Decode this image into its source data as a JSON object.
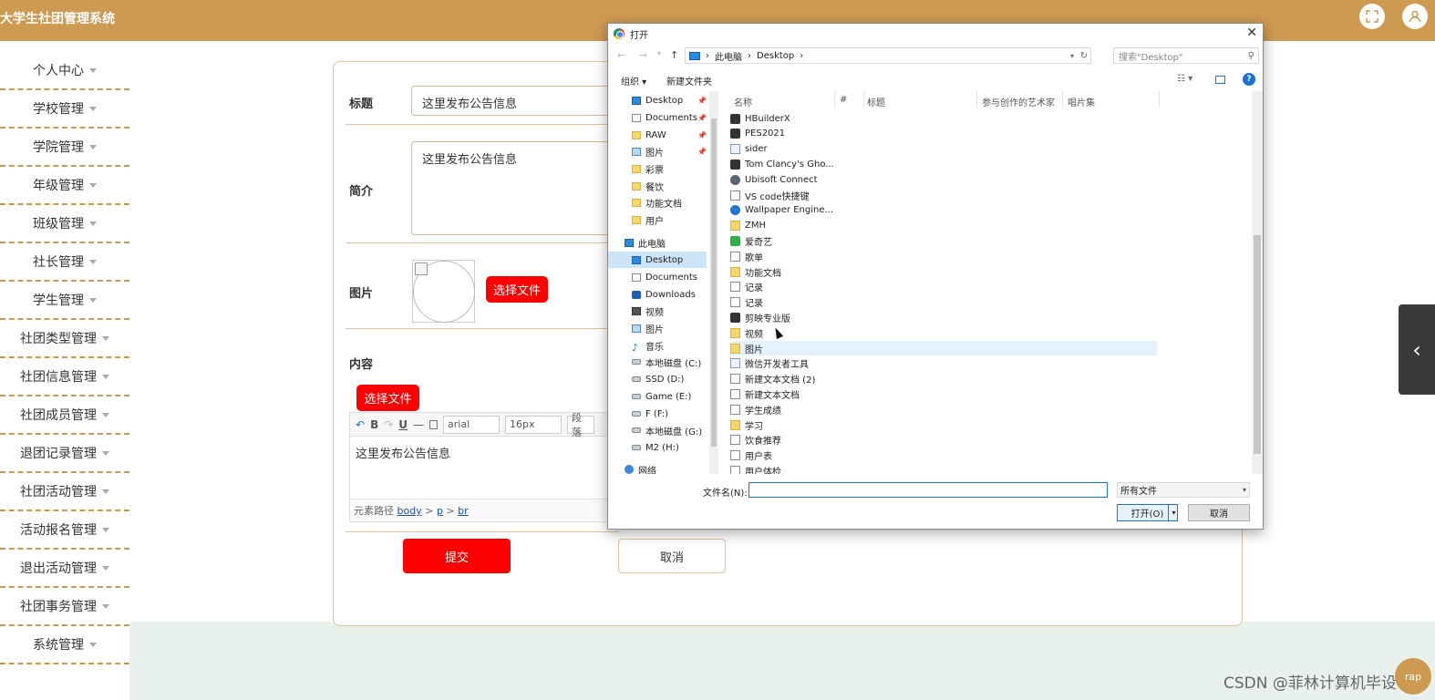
{
  "app": {
    "title": "大学生社团管理系统"
  },
  "sidebar": {
    "items": [
      {
        "label": "个人中心"
      },
      {
        "label": "学校管理"
      },
      {
        "label": "学院管理"
      },
      {
        "label": "年级管理"
      },
      {
        "label": "班级管理"
      },
      {
        "label": "社长管理"
      },
      {
        "label": "学生管理"
      },
      {
        "label": "社团类型管理"
      },
      {
        "label": "社团信息管理"
      },
      {
        "label": "社团成员管理"
      },
      {
        "label": "退团记录管理"
      },
      {
        "label": "社团活动管理"
      },
      {
        "label": "活动报名管理"
      },
      {
        "label": "退出活动管理"
      },
      {
        "label": "社团事务管理"
      },
      {
        "label": "系统管理"
      }
    ]
  },
  "form": {
    "title_label": "标题",
    "title_value": "这里发布公告信息",
    "intro_label": "简介",
    "intro_value": "这里发布公告信息",
    "image_label": "图片",
    "choose_file": "选择文件",
    "content_label": "内容",
    "content_choose_file": "选择文件",
    "editor": {
      "font": "arial",
      "size": "16px",
      "para": "段落",
      "content": "这里发布公告信息",
      "path_label": "元素路径",
      "path": [
        "body",
        "p",
        "br"
      ],
      "bold": "B",
      "underline": "U",
      "hr": "—"
    },
    "submit": "提交",
    "cancel": "取消"
  },
  "watermark": "CSDN @菲林计算机毕设",
  "corner_badge": "rap",
  "dialog": {
    "title": "打开",
    "breadcrumb": [
      "此电脑",
      "Desktop"
    ],
    "search_placeholder": "搜索\"Desktop\"",
    "organize": "组织 ▾",
    "new_folder": "新建文件夹",
    "help": "?",
    "nav": [
      {
        "label": "Desktop",
        "icon": "blue",
        "pin": true
      },
      {
        "label": "Documents",
        "icon": "doc",
        "pin": true
      },
      {
        "label": "RAW",
        "icon": "folder",
        "pin": true
      },
      {
        "label": "图片",
        "icon": "pic",
        "pin": true
      },
      {
        "label": "彩票",
        "icon": "folder"
      },
      {
        "label": "餐饮",
        "icon": "folder"
      },
      {
        "label": "功能文档",
        "icon": "folder"
      },
      {
        "label": "用户",
        "icon": "folder"
      },
      {
        "label": "此电脑",
        "icon": "blue"
      },
      {
        "label": "Desktop",
        "icon": "blue",
        "selected": true
      },
      {
        "label": "Documents",
        "icon": "doc"
      },
      {
        "label": "Downloads",
        "icon": "down"
      },
      {
        "label": "视频",
        "icon": "video"
      },
      {
        "label": "图片",
        "icon": "pic"
      },
      {
        "label": "音乐",
        "icon": "music"
      },
      {
        "label": "本地磁盘 (C:)",
        "icon": "drive"
      },
      {
        "label": "SSD (D:)",
        "icon": "drive"
      },
      {
        "label": "Game (E:)",
        "icon": "drive"
      },
      {
        "label": "F (F:)",
        "icon": "drive"
      },
      {
        "label": "本地磁盘 (G:)",
        "icon": "drive"
      },
      {
        "label": "M2 (H:)",
        "icon": "drive"
      },
      {
        "label": "网络",
        "icon": "net"
      }
    ],
    "columns": [
      "名称",
      "#",
      "标题",
      "参与创作的艺术家",
      "唱片集"
    ],
    "files": [
      {
        "name": "HBuilderX",
        "icon": "app"
      },
      {
        "name": "PES2021",
        "icon": "app"
      },
      {
        "name": "sider",
        "icon": "shortcut"
      },
      {
        "name": "Tom Clancy's Gho...",
        "icon": "app"
      },
      {
        "name": "Ubisoft Connect",
        "icon": "gray"
      },
      {
        "name": "VS code快捷键",
        "icon": "txt"
      },
      {
        "name": "Wallpaper Engine...",
        "icon": "blue"
      },
      {
        "name": "ZMH",
        "icon": "folder"
      },
      {
        "name": "爱奇艺",
        "icon": "green"
      },
      {
        "name": "歌单",
        "icon": "txt"
      },
      {
        "name": "功能文档",
        "icon": "folder"
      },
      {
        "name": "记录",
        "icon": "txt"
      },
      {
        "name": "记录",
        "icon": "txt"
      },
      {
        "name": "剪映专业版",
        "icon": "app"
      },
      {
        "name": "视频",
        "icon": "folder"
      },
      {
        "name": "图片",
        "icon": "folder",
        "hover": true
      },
      {
        "name": "微信开发者工具",
        "icon": "shortcut"
      },
      {
        "name": "新建文本文档 (2)",
        "icon": "txt"
      },
      {
        "name": "新建文本文档",
        "icon": "txt"
      },
      {
        "name": "学生成绩",
        "icon": "txt"
      },
      {
        "name": "学习",
        "icon": "folder"
      },
      {
        "name": "饮食推荐",
        "icon": "txt"
      },
      {
        "name": "用户表",
        "icon": "txt"
      },
      {
        "name": "用户体检",
        "icon": "txt"
      }
    ],
    "filename_label": "文件名(N):",
    "filename_value": "",
    "filter": "所有文件",
    "open": "打开(O)",
    "cancel": "取消"
  }
}
